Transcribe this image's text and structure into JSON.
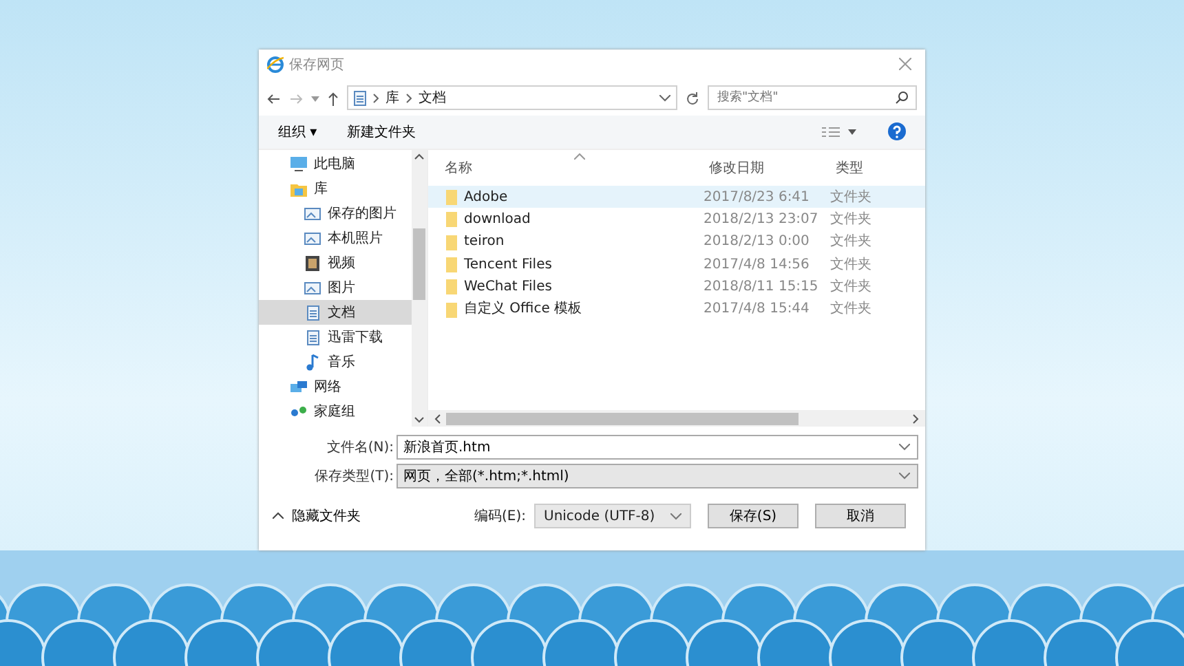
{
  "window": {
    "title": "保存网页"
  },
  "address": {
    "path": [
      "库",
      "文档"
    ],
    "search_placeholder": "搜索\"文档\""
  },
  "toolbar": {
    "organize": "组织 ▾",
    "new_folder": "新建文件夹"
  },
  "sidebar": {
    "items": [
      {
        "label": "此电脑",
        "kind": "pc",
        "selected": false
      },
      {
        "label": "库",
        "kind": "library",
        "selected": false,
        "children": [
          {
            "label": "保存的图片",
            "kind": "picture",
            "selected": false
          },
          {
            "label": "本机照片",
            "kind": "picture",
            "selected": false
          },
          {
            "label": "视频",
            "kind": "video",
            "selected": false
          },
          {
            "label": "图片",
            "kind": "picture",
            "selected": false
          },
          {
            "label": "文档",
            "kind": "doc",
            "selected": true
          },
          {
            "label": "迅雷下载",
            "kind": "doc",
            "selected": false
          },
          {
            "label": "音乐",
            "kind": "music",
            "selected": false
          }
        ]
      },
      {
        "label": "网络",
        "kind": "network",
        "selected": false
      },
      {
        "label": "家庭组",
        "kind": "homegroup",
        "selected": false
      }
    ]
  },
  "table": {
    "columns": [
      "名称",
      "修改日期",
      "类型"
    ],
    "rows": [
      {
        "name": "Adobe",
        "date": "2017/8/23 6:41",
        "type": "文件夹",
        "selected": true
      },
      {
        "name": "download",
        "date": "2018/2/13 23:07",
        "type": "文件夹",
        "selected": false
      },
      {
        "name": "teiron",
        "date": "2018/2/13 0:00",
        "type": "文件夹",
        "selected": false
      },
      {
        "name": "Tencent Files",
        "date": "2017/4/8 14:56",
        "type": "文件夹",
        "selected": false
      },
      {
        "name": "WeChat Files",
        "date": "2018/8/11 15:15",
        "type": "文件夹",
        "selected": false
      },
      {
        "name": "自定义 Office 模板",
        "date": "2017/4/8 15:44",
        "type": "文件夹",
        "selected": false
      }
    ]
  },
  "form": {
    "filename_label": "文件名(N):",
    "filename": "新浪首页.htm",
    "type_label": "保存类型(T):",
    "type": "网页，全部(*.htm;*.html)"
  },
  "footer": {
    "hide_folders": "隐藏文件夹",
    "encoding_label": "编码(E):",
    "encoding": "Unicode (UTF-8)",
    "buttons": [
      "保存(S)",
      "取消"
    ]
  }
}
